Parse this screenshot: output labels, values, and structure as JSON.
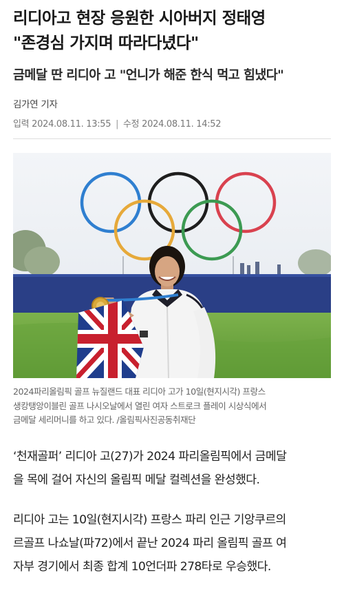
{
  "article": {
    "title_line1": "리디아고 현장 응원한 시아버지 정태영",
    "title_line2": "\"존경심 가지며 따라다녔다\"",
    "subtitle": "금메달 딴 리디아 고 \"언니가 해준 한식 먹고 힘냈다\"",
    "reporter": "김가연 기자",
    "published": "입력 2024.08.11. 13:55",
    "separator": "|",
    "modified": "수정 2024.08.11. 14:52"
  },
  "photo": {
    "caption_line1": "2024파리올림픽 골프 뉴질랜드 대표 리디아 고가 10일(현지시각) 프랑스",
    "caption_line2": "생캉탱앙이블린 골프 나시오날에서 열린 여자 스트로크 플레이 시상식에서",
    "caption_line3": "금메달 세리머니를 하고 있다. /올림픽사진공동취재단",
    "colors": {
      "sky": "#eef1f4",
      "ring_blue": "#2f7fd0",
      "ring_black": "#1e1e1e",
      "ring_red": "#d9424f",
      "ring_yellow": "#e6a93a",
      "ring_green": "#3c9a52",
      "wall": "#2a3f86",
      "grass": "#6aa43f"
    }
  },
  "body": {
    "p1_line1": "‘천재골퍼’ 리디아 고(27)가 2024 파리올림픽에서 금메달",
    "p1_line2": "을 목에 걸어 자신의 올림픽 메달 컬렉션을 완성했다.",
    "p2_line1": "리디아 고는 10일(현지시각) 프랑스 파리 인근 기앙쿠르의",
    "p2_line2": "르골프 나쇼날(파72)에서 끝난 2024 파리 올림픽 골프 여",
    "p2_line3": "자부 경기에서 최종 합계 10언더파 278타로 우승했다."
  }
}
